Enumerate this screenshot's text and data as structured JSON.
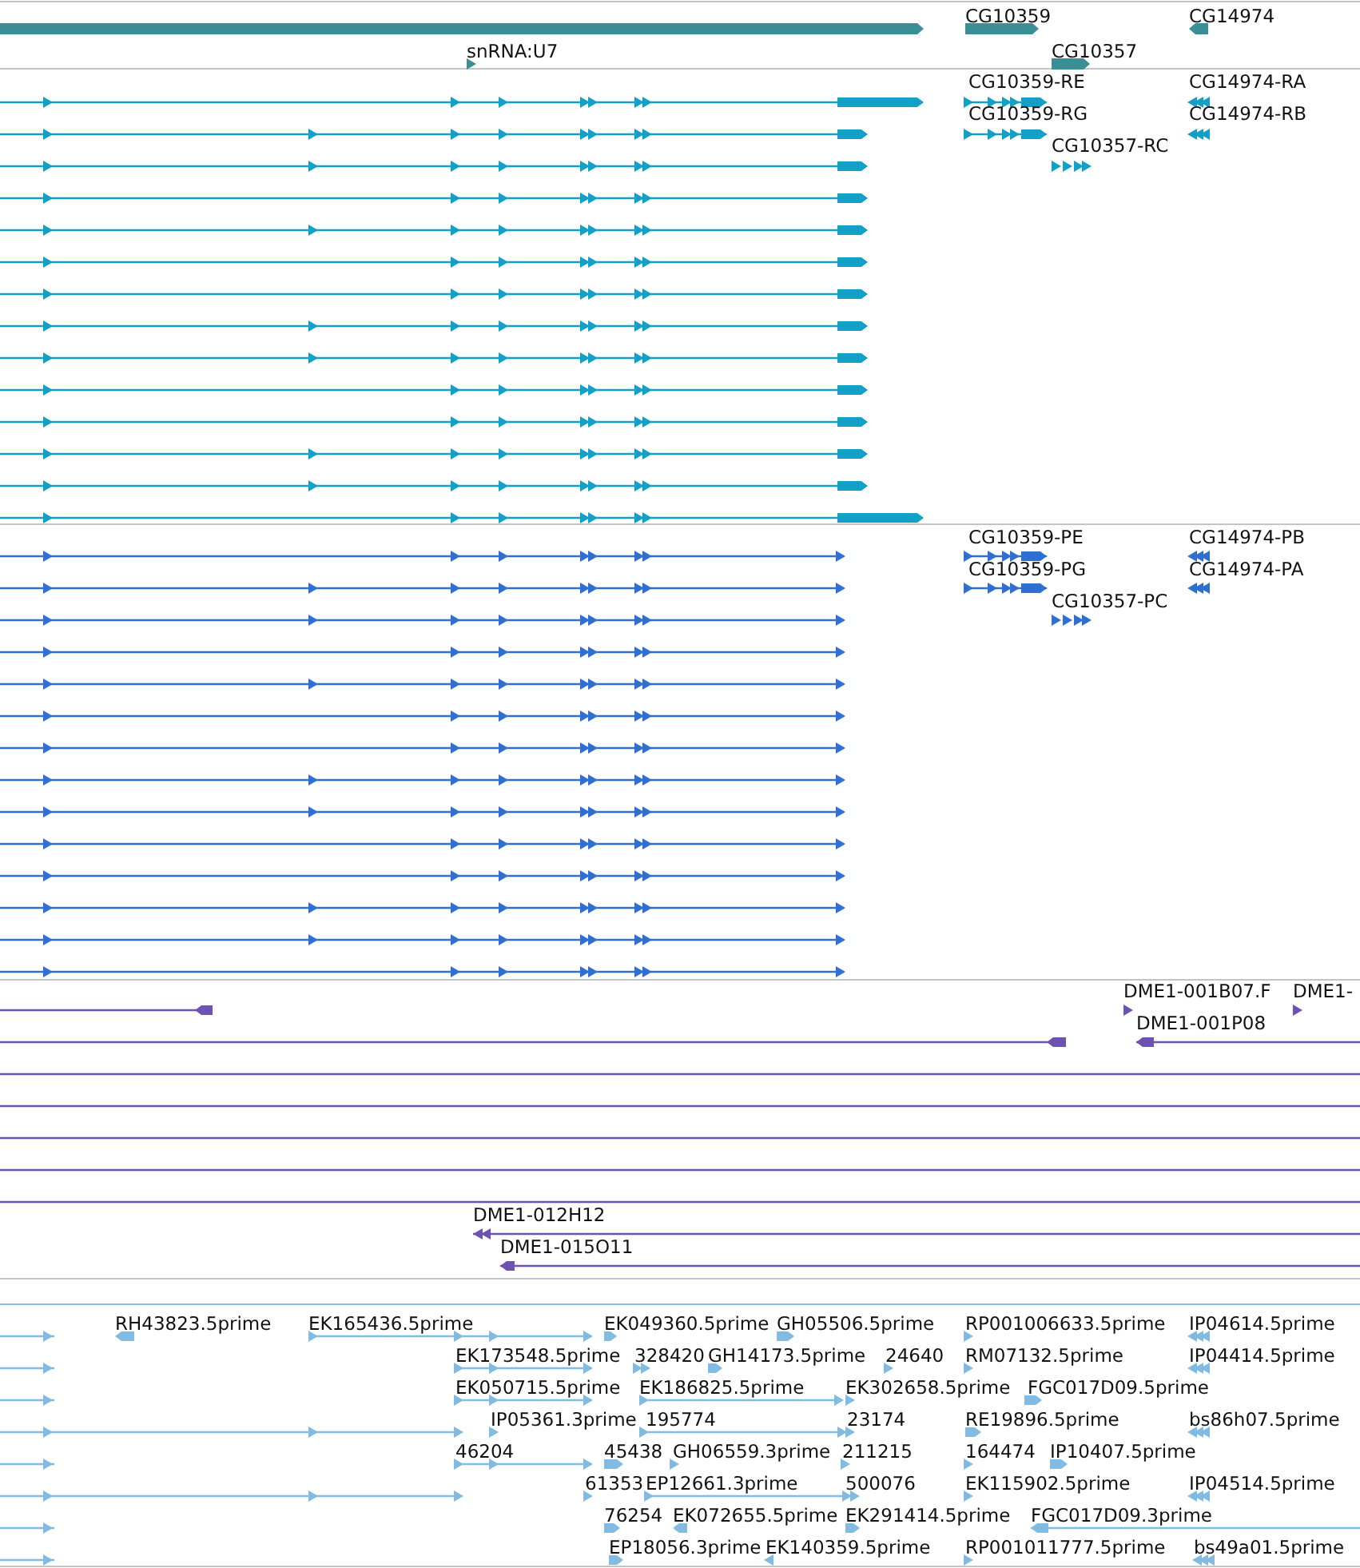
{
  "tracks": [
    {
      "kind": "gene",
      "features": [
        {
          "label": "CG10359",
          "reverse": false
        },
        {
          "label": "CG14974",
          "reverse": true
        },
        {
          "label": "snRNA:U7",
          "reverse": false
        },
        {
          "label": "CG10357",
          "reverse": false
        }
      ]
    },
    {
      "kind": "transcript",
      "features": [
        {
          "label": "CG10359-RE",
          "reverse": false
        },
        {
          "label": "CG14974-RA",
          "reverse": true
        },
        {
          "label": "CG10359-RG",
          "reverse": false
        },
        {
          "label": "CG14974-RB",
          "reverse": true
        },
        {
          "label": "CG10357-RC",
          "reverse": false
        }
      ]
    },
    {
      "kind": "protein",
      "features": [
        {
          "label": "CG10359-PE",
          "reverse": false
        },
        {
          "label": "CG14974-PB",
          "reverse": true
        },
        {
          "label": "CG10359-PG",
          "reverse": false
        },
        {
          "label": "CG14974-PA",
          "reverse": true
        },
        {
          "label": "CG10357-PC",
          "reverse": false
        }
      ]
    },
    {
      "kind": "clone",
      "features": [
        {
          "label": "DME1-001B07.F",
          "reverse": false
        },
        {
          "label": "DME1-",
          "reverse": false
        },
        {
          "label": "DME1-001P08",
          "reverse": true
        },
        {
          "label": "DME1-012H12",
          "reverse": true
        },
        {
          "label": "DME1-015O11",
          "reverse": true
        }
      ]
    },
    {
      "kind": "est",
      "features": [
        {
          "label": "RH43823.5prime",
          "reverse": true
        },
        {
          "label": "EK165436.5prime",
          "reverse": false
        },
        {
          "label": "EK049360.5prime",
          "reverse": false
        },
        {
          "label": "GH05506.5prime",
          "reverse": false
        },
        {
          "label": "RP001006633.5prime",
          "reverse": false
        },
        {
          "label": "IP04614.5prime",
          "reverse": true
        },
        {
          "label": "EK173548.5prime",
          "reverse": false
        },
        {
          "label": "328420",
          "reverse": false
        },
        {
          "label": "GH14173.5prime",
          "reverse": false
        },
        {
          "label": "24640",
          "reverse": false
        },
        {
          "label": "RM07132.5prime",
          "reverse": false
        },
        {
          "label": "IP04414.5prime",
          "reverse": true
        },
        {
          "label": "EK050715.5prime",
          "reverse": false
        },
        {
          "label": "EK186825.5prime",
          "reverse": false
        },
        {
          "label": "EK302658.5prime",
          "reverse": false
        },
        {
          "label": "FGC017D09.5prime",
          "reverse": false
        },
        {
          "label": "IP05361.3prime",
          "reverse": false
        },
        {
          "label": "195774",
          "reverse": false
        },
        {
          "label": "23174",
          "reverse": false
        },
        {
          "label": "RE19896.5prime",
          "reverse": false
        },
        {
          "label": "bs86h07.5prime",
          "reverse": true
        },
        {
          "label": "46204",
          "reverse": false
        },
        {
          "label": "45438",
          "reverse": false
        },
        {
          "label": "GH06559.3prime",
          "reverse": false
        },
        {
          "label": "211215",
          "reverse": false
        },
        {
          "label": "164474",
          "reverse": false
        },
        {
          "label": "IP10407.5prime",
          "reverse": false
        },
        {
          "label": "61353",
          "reverse": false
        },
        {
          "label": "EP12661.3prime",
          "reverse": false
        },
        {
          "label": "500076",
          "reverse": false
        },
        {
          "label": "EK115902.5prime",
          "reverse": false
        },
        {
          "label": "IP04514.5prime",
          "reverse": true
        },
        {
          "label": "76254",
          "reverse": false
        },
        {
          "label": "EK072655.5prime",
          "reverse": true
        },
        {
          "label": "EK291414.5prime",
          "reverse": false
        },
        {
          "label": "FGC017D09.3prime",
          "reverse": true
        },
        {
          "label": "EP18056.3prime",
          "reverse": false
        },
        {
          "label": "EK140359.5prime",
          "reverse": true
        },
        {
          "label": "RP001011777.5prime",
          "reverse": false
        },
        {
          "label": "bs49a01.5prime",
          "reverse": true
        }
      ]
    }
  ]
}
